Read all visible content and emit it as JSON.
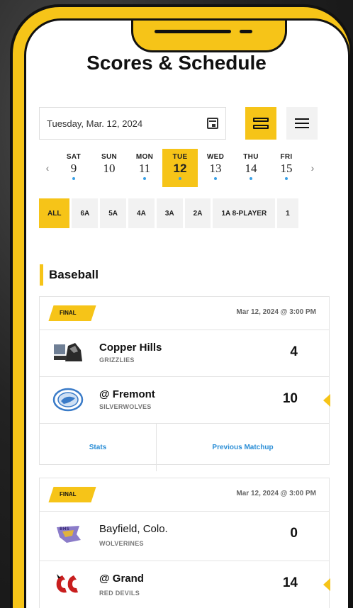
{
  "page": {
    "title": "Scores & Schedule"
  },
  "date_picker": {
    "value": "Tuesday, Mar. 12, 2024",
    "icon": "calendar-icon"
  },
  "view_toggle": {
    "cards_icon": "cards-view-icon",
    "list_icon": "list-view-icon"
  },
  "days": [
    {
      "name": "SAT",
      "num": "9",
      "has_games": true,
      "active": false
    },
    {
      "name": "SUN",
      "num": "10",
      "has_games": false,
      "active": false
    },
    {
      "name": "MON",
      "num": "11",
      "has_games": true,
      "active": false
    },
    {
      "name": "TUE",
      "num": "12",
      "has_games": true,
      "active": true
    },
    {
      "name": "WED",
      "num": "13",
      "has_games": true,
      "active": false
    },
    {
      "name": "THU",
      "num": "14",
      "has_games": true,
      "active": false
    },
    {
      "name": "FRI",
      "num": "15",
      "has_games": true,
      "active": false
    }
  ],
  "classes": [
    "ALL",
    "6A",
    "5A",
    "4A",
    "3A",
    "2A",
    "1A 8-PLAYER",
    "1"
  ],
  "sport": "Baseball",
  "games": [
    {
      "status": "FINAL",
      "datetime": "Mar 12, 2024 @ 3:00 PM",
      "away": {
        "name": "Copper Hills",
        "mascot": "GRIZZLIES",
        "score": "4",
        "logo": "copper-hills-logo"
      },
      "home": {
        "name": "@ Fremont",
        "mascot": "SILVERWOLVES",
        "score": "10",
        "logo": "fremont-logo",
        "winner": true
      },
      "actions": {
        "stats": "Stats",
        "previous": "Previous Matchup"
      }
    },
    {
      "status": "FINAL",
      "datetime": "Mar 12, 2024 @ 3:00 PM",
      "away": {
        "name": "Bayfield, Colo.",
        "mascot": "WOLVERINES",
        "score": "0",
        "logo": "bayfield-logo"
      },
      "home": {
        "name": "@ Grand",
        "mascot": "RED DEVILS",
        "score": "14",
        "logo": "grand-logo",
        "winner": true
      }
    }
  ],
  "colors": {
    "accent": "#f6c418",
    "link": "#2b8ed6",
    "dot": "#3aa0e6"
  }
}
